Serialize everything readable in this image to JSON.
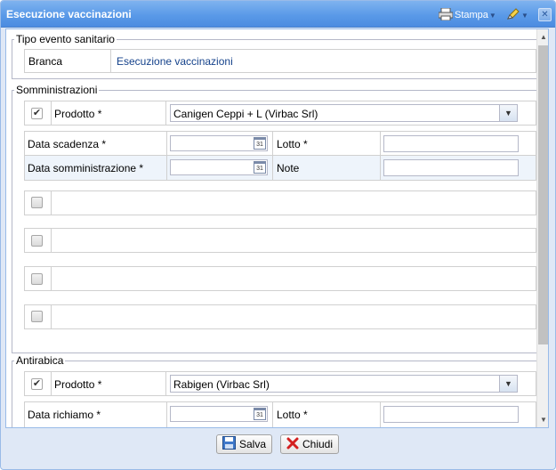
{
  "window": {
    "title": "Esecuzione vaccinazioni"
  },
  "toolbar": {
    "stampa_label": "Stampa"
  },
  "tipo_evento": {
    "legend": "Tipo evento sanitario",
    "branca_label": "Branca",
    "branca_value": "Esecuzione vaccinazioni"
  },
  "somministrazioni": {
    "legend": "Somministrazioni",
    "prodotto_label": "Prodotto *",
    "prodotto_value": "Canigen Ceppi + L (Virbac Srl)",
    "data_scadenza_label": "Data scadenza *",
    "lotto_label": "Lotto *",
    "data_somministrazione_label": "Data somministrazione *",
    "note_label": "Note"
  },
  "antirabica": {
    "legend": "Antirabica",
    "prodotto_label": "Prodotto *",
    "prodotto_value": "Rabigen (Virbac Srl)",
    "data_richiamo_label": "Data richiamo *",
    "lotto_label": "Lotto *"
  },
  "footer": {
    "salva_label": "Salva",
    "chiudi_label": "Chiudi"
  },
  "colors": {
    "title_bar": "#5a9ae8",
    "link": "#15428b",
    "border": "#99bbe8"
  }
}
